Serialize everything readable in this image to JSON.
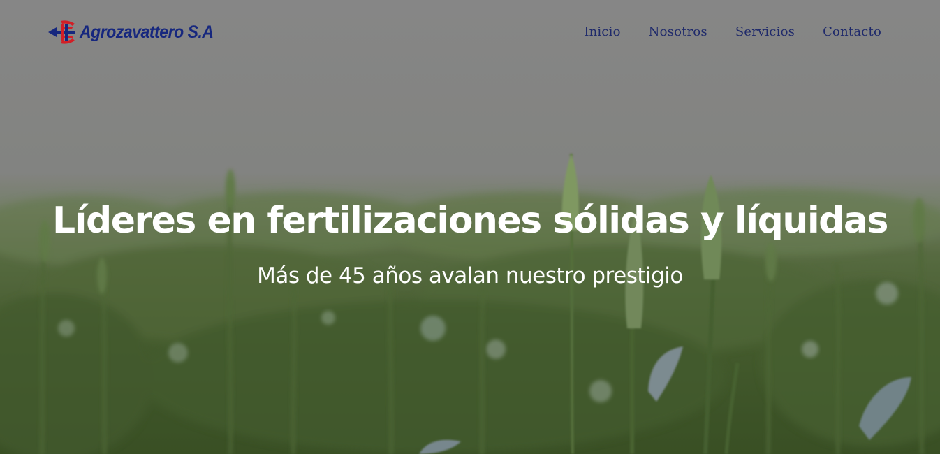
{
  "brand": {
    "name": "Agrozavattero S.A",
    "logo_icon": "company-emblem-icon",
    "colors": {
      "blue": "#16277e",
      "red": "#d21f26"
    }
  },
  "nav": {
    "items": [
      {
        "label": "Inicio"
      },
      {
        "label": "Nosotros"
      },
      {
        "label": "Servicios"
      },
      {
        "label": "Contacto"
      }
    ],
    "color": "#1f2a6b"
  },
  "hero": {
    "title": "Líderes en fertilizaciones sólidas y líquidas",
    "subtitle": "Más de 45 años avalan nuestro prestigio",
    "text_color": "#ffffff",
    "background": "wheat-field-photo",
    "sky_color": "#909090",
    "field_color": "#4f6a34"
  }
}
